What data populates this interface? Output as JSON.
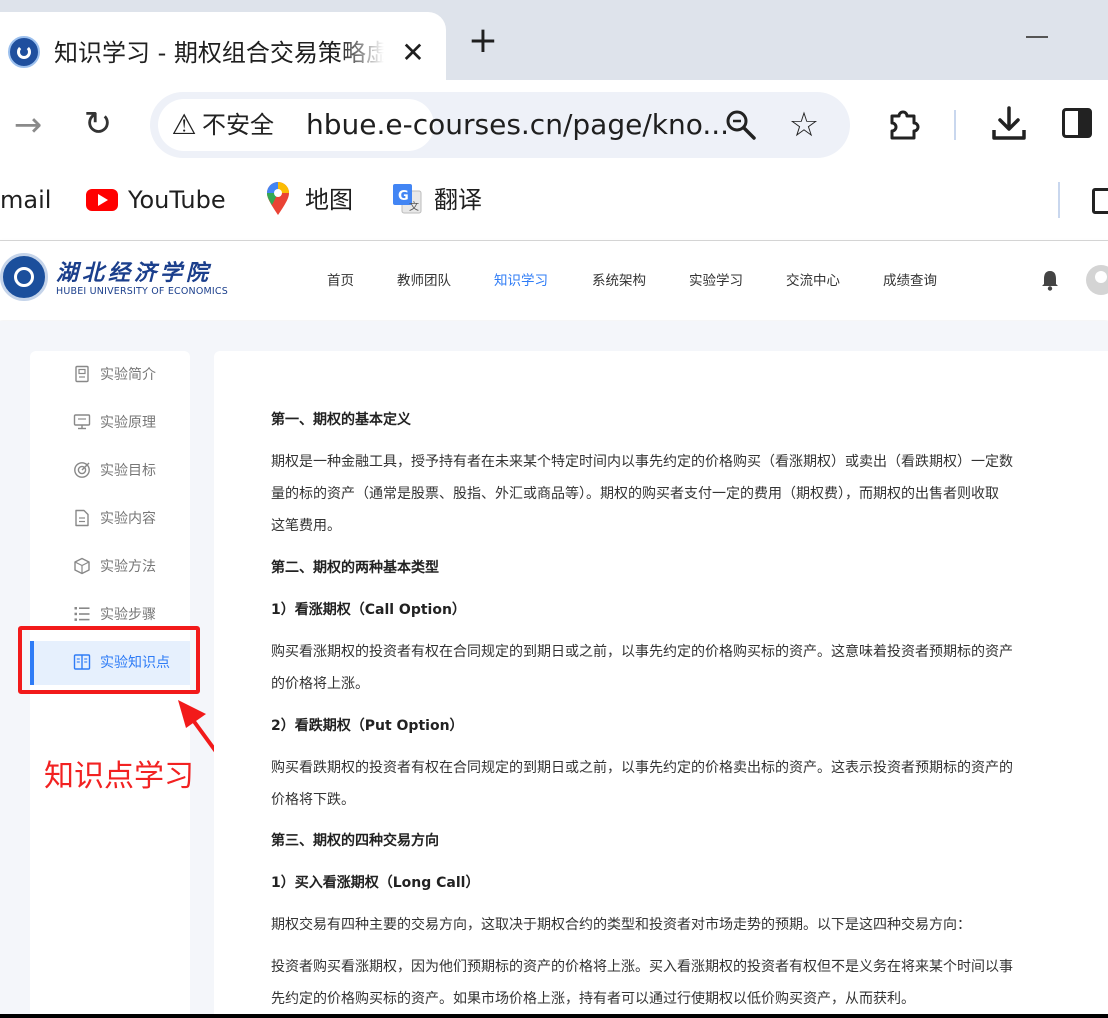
{
  "browser": {
    "tab_title": "知识学习 - 期权组合交易策略虚",
    "tab_close": "✕",
    "new_tab": "+",
    "security_label": "不安全",
    "url": "hbue.e-courses.cn/page/kno...",
    "bookmarks": [
      "mail",
      "YouTube",
      "地图",
      "翻译"
    ]
  },
  "site": {
    "logo_cn": "湖北经济学院",
    "logo_en": "HUBEI UNIVERSITY OF ECONOMICS",
    "nav": [
      "首页",
      "教师团队",
      "知识学习",
      "系统架构",
      "实验学习",
      "交流中心",
      "成绩查询"
    ],
    "active_nav": "知识学习"
  },
  "sidebar": {
    "items": [
      {
        "label": "实验简介",
        "icon": "document-icon"
      },
      {
        "label": "实验原理",
        "icon": "monitor-icon"
      },
      {
        "label": "实验目标",
        "icon": "target-icon"
      },
      {
        "label": "实验内容",
        "icon": "file-text-icon"
      },
      {
        "label": "实验方法",
        "icon": "cube-icon"
      },
      {
        "label": "实验步骤",
        "icon": "list-icon"
      },
      {
        "label": "实验知识点",
        "icon": "book-icon",
        "active": true
      }
    ]
  },
  "annotation": {
    "label": "知识点学习",
    "color": "#f21a1a"
  },
  "article": {
    "lines": [
      {
        "text": "第一、期权的基本定义",
        "heading": true
      },
      {
        "text": "期权是一种金融工具，授予持有者在未来某个特定时间内以事先约定的价格购买（看涨期权）或卖出（看跌期权）一定数"
      },
      {
        "text": "量的标的资产（通常是股票、股指、外汇或商品等）。期权的购买者支付一定的费用（期权费），而期权的出售者则收取"
      },
      {
        "text": "这笔费用。"
      },
      {
        "text": "第二、期权的两种基本类型",
        "heading": true
      },
      {
        "text": "1）看涨期权（Call Option）",
        "heading": true
      },
      {
        "text": "购买看涨期权的投资者有权在合同规定的到期日或之前，以事先约定的价格购买标的资产。这意味着投资者预期标的资产"
      },
      {
        "text": "的价格将上涨。"
      },
      {
        "text": "2）看跌期权（Put Option）",
        "heading": true
      },
      {
        "text": "购买看跌期权的投资者有权在合同规定的到期日或之前，以事先约定的价格卖出标的资产。这表示投资者预期标的资产的"
      },
      {
        "text": "价格将下跌。"
      },
      {
        "text": "第三、期权的四种交易方向",
        "heading": true
      },
      {
        "text": "1）买入看涨期权（Long Call）",
        "heading": true
      },
      {
        "text": "期权交易有四种主要的交易方向，这取决于期权合约的类型和投资者对市场走势的预期。以下是这四种交易方向："
      },
      {
        "text": "投资者购买看涨期权，因为他们预期标的资产的价格将上涨。买入看涨期权的投资者有权但不是义务在将来某个时间以事"
      },
      {
        "text": "先约定的价格购买标的资产。如果市场价格上涨，持有者可以通过行使期权以低价购买资产，从而获利。"
      }
    ]
  },
  "colors": {
    "accent": "#2f7cf6",
    "annotation": "#f21a1a",
    "youtube": "#ff0000",
    "brand_navy": "#1b3f8c"
  }
}
